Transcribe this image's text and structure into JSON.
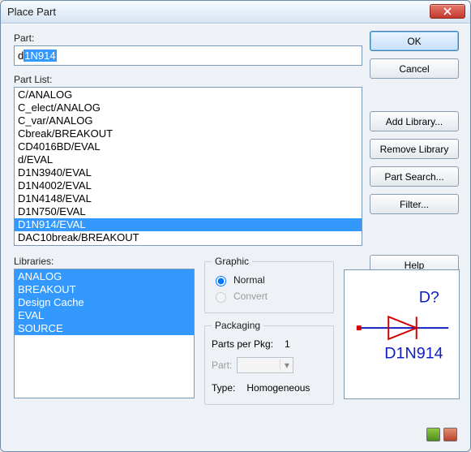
{
  "window": {
    "title": "Place Part"
  },
  "labels": {
    "part": "Part:",
    "part_list": "Part List:",
    "libraries": "Libraries:",
    "graphic": "Graphic",
    "packaging": "Packaging",
    "parts_per_pkg": "Parts per Pkg:",
    "part_label": "Part:",
    "type_label": "Type:"
  },
  "part_field": {
    "prefix": "d",
    "selected": "1N914"
  },
  "buttons": {
    "ok": "OK",
    "cancel": "Cancel",
    "add_library": "Add Library...",
    "remove_library": "Remove Library",
    "part_search": "Part Search...",
    "filter": "Filter...",
    "help": "Help"
  },
  "part_list": [
    "C/ANALOG",
    "C_elect/ANALOG",
    "C_var/ANALOG",
    "Cbreak/BREAKOUT",
    "CD4016BD/EVAL",
    "d/EVAL",
    "D1N3940/EVAL",
    "D1N4002/EVAL",
    "D1N4148/EVAL",
    "D1N750/EVAL",
    "D1N914/EVAL",
    "DAC10break/BREAKOUT"
  ],
  "part_list_selected_index": 10,
  "libraries": [
    "ANALOG",
    "BREAKOUT",
    "Design Cache",
    "EVAL",
    "SOURCE"
  ],
  "graphic": {
    "normal": "Normal",
    "convert": "Convert"
  },
  "packaging": {
    "parts_per_pkg_value": "1",
    "part_value": "",
    "type_value": "Homogeneous"
  },
  "preview": {
    "ref": "D?",
    "name": "D1N914"
  }
}
